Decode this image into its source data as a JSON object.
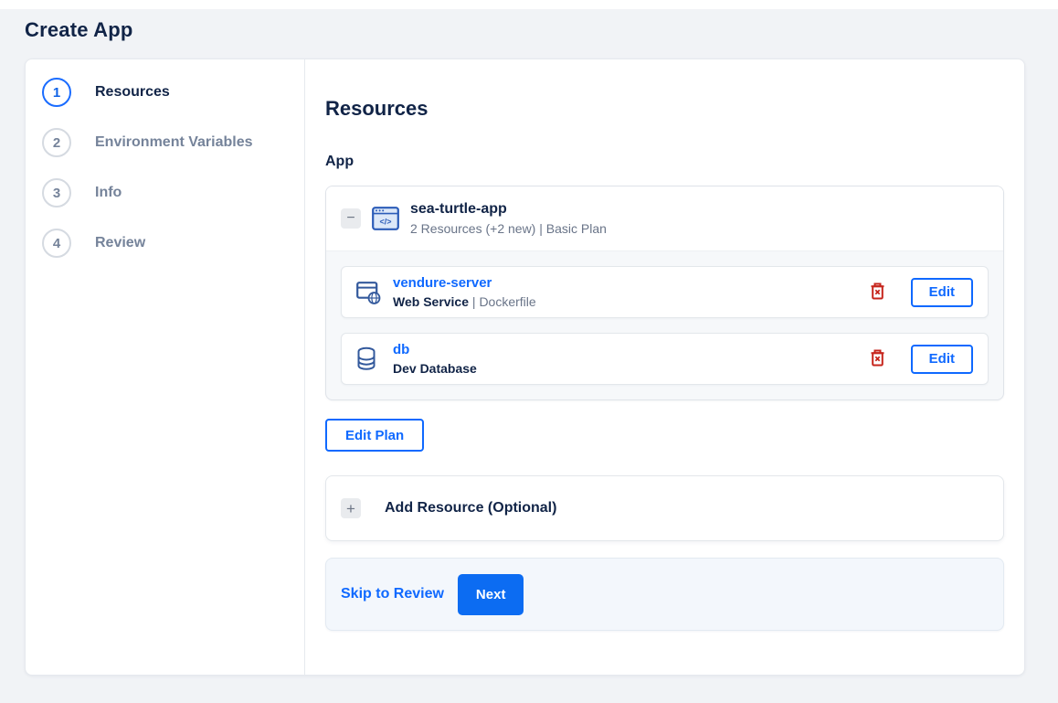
{
  "page": {
    "title": "Create App"
  },
  "colors": {
    "accent_blue": "#0f69ff",
    "next_button_blue": "#0c6cf2",
    "heading_navy": "#112447",
    "muted_gray": "#697488",
    "danger_red": "#c6251c",
    "page_background": "#f1f3f6",
    "footer_background": "#f3f7fc",
    "icon_blue": "#33599c"
  },
  "icons": [
    "minus-icon",
    "code-window-icon",
    "web-service-icon",
    "database-icon",
    "trash-icon",
    "plus-icon"
  ],
  "steps": [
    {
      "number": "1",
      "label": "Resources",
      "active": true
    },
    {
      "number": "2",
      "label": "Environment Variables",
      "active": false
    },
    {
      "number": "3",
      "label": "Info",
      "active": false
    },
    {
      "number": "4",
      "label": "Review",
      "active": false
    }
  ],
  "content": {
    "heading": "Resources",
    "section_label": "App",
    "app": {
      "name": "sea-turtle-app",
      "meta": "2 Resources (+2 new) | Basic Plan",
      "collapse_glyph": "−",
      "resources": [
        {
          "name": "vendure-server",
          "type": "Web Service",
          "separator": " | ",
          "source": "Dockerfile",
          "edit_label": "Edit"
        },
        {
          "name": "db",
          "type": "Dev Database",
          "separator": "",
          "source": "",
          "edit_label": "Edit"
        }
      ]
    },
    "edit_plan_label": "Edit Plan",
    "add_resource": {
      "plus_glyph": "+",
      "label": "Add Resource (Optional)"
    },
    "footer": {
      "skip_label": "Skip to Review",
      "next_label": "Next"
    }
  }
}
